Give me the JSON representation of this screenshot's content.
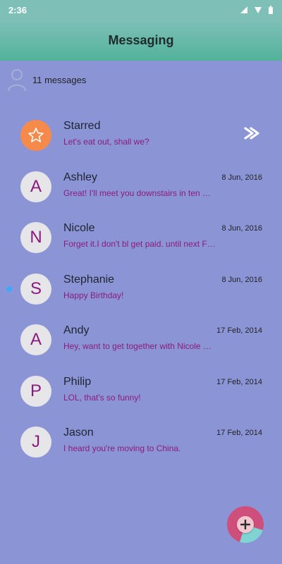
{
  "status": {
    "time": "2:36",
    "icons": [
      "signal-icon",
      "wifi-icon",
      "battery-icon"
    ]
  },
  "header": {
    "title": "Messaging"
  },
  "summary": {
    "text": "11 messages",
    "icon": "person-icon"
  },
  "conversations": [
    {
      "name": "Starred",
      "snippet": "Let's eat out, shall we?",
      "date": "",
      "avatar": "star-icon",
      "avatar_color": "#f58a4a"
    },
    {
      "name": "Ashley",
      "snippet": "Great! I'll meet you downstairs in ten …",
      "date": "8 Jun, 2016",
      "avatar": "A"
    },
    {
      "name": "Nicole",
      "snippet": "Forget it.I don't bl get paid. until next F…",
      "date": "8 Jun, 2016",
      "avatar": "N"
    },
    {
      "name": "Stephanie",
      "snippet": "Happy Birthday!",
      "date": "8 Jun, 2016",
      "avatar": "S",
      "unread": true
    },
    {
      "name": "Andy",
      "snippet": "Hey, want to get together with Nicole …",
      "date": "17 Feb, 2014",
      "avatar": "A"
    },
    {
      "name": "Philip",
      "snippet": "LOL, that's so funny!",
      "date": "17 Feb, 2014",
      "avatar": "P"
    },
    {
      "name": "Jason",
      "snippet": "I heard you're moving to China.",
      "date": "17 Feb, 2014",
      "avatar": "J"
    }
  ],
  "fab": {
    "icon": "plus-icon"
  },
  "colors": {
    "background": "#8b95d6",
    "accent": "#52b29a",
    "snippet": "#8a1a7e",
    "unread": "#3da8ff"
  }
}
